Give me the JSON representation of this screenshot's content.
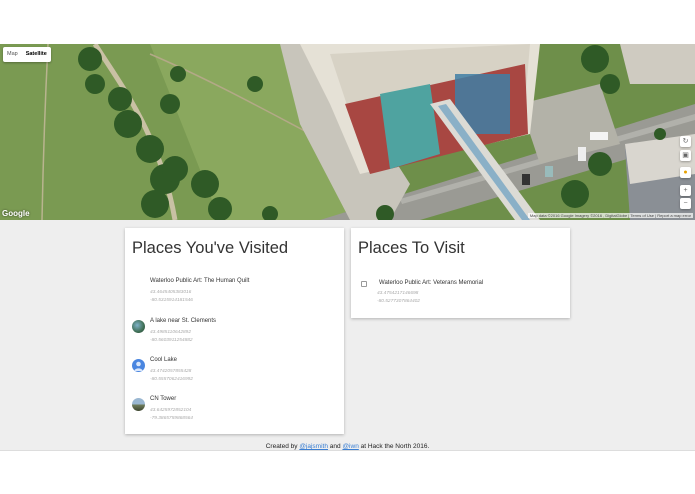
{
  "map": {
    "type_map_label": "Map",
    "type_satellite_label": "Satellite",
    "logo": "Google",
    "attribution": "Map data ©2016 Google Imagery ©2016 , DigitalGlobe | Terms of Use | Report a map error"
  },
  "visited": {
    "title": "Places You've Visited",
    "items": [
      {
        "name": "Waterloo Public Art: The Human Quilt",
        "lat": "43.4645405383016",
        "lng": "-80.5315914181546"
      },
      {
        "name": "A lake near St. Clements",
        "lat": "43.4985110642892",
        "lng": "-80.5603911254882"
      },
      {
        "name": "Cool Lake",
        "lat": "43.4742057855428",
        "lng": "-80.5557062416992"
      },
      {
        "name": "CN Tower",
        "lat": "43.6425972852104",
        "lng": "-79.3865759868564"
      }
    ]
  },
  "to_visit": {
    "title": "Places To Visit",
    "items": [
      {
        "name": "Waterloo Public Art: Veterans Memorial",
        "lat": "43.4754217146698",
        "lng": "-80.5277307864402"
      }
    ]
  },
  "footer": {
    "prefix": "Created by",
    "author1": "@jajsmith",
    "and": "and",
    "author2": "@iwn",
    "suffix": "at Hack the North 2016."
  },
  "colors": {
    "background": "#eeeeee",
    "link": "#3b7fd3",
    "card": "#ffffff"
  }
}
